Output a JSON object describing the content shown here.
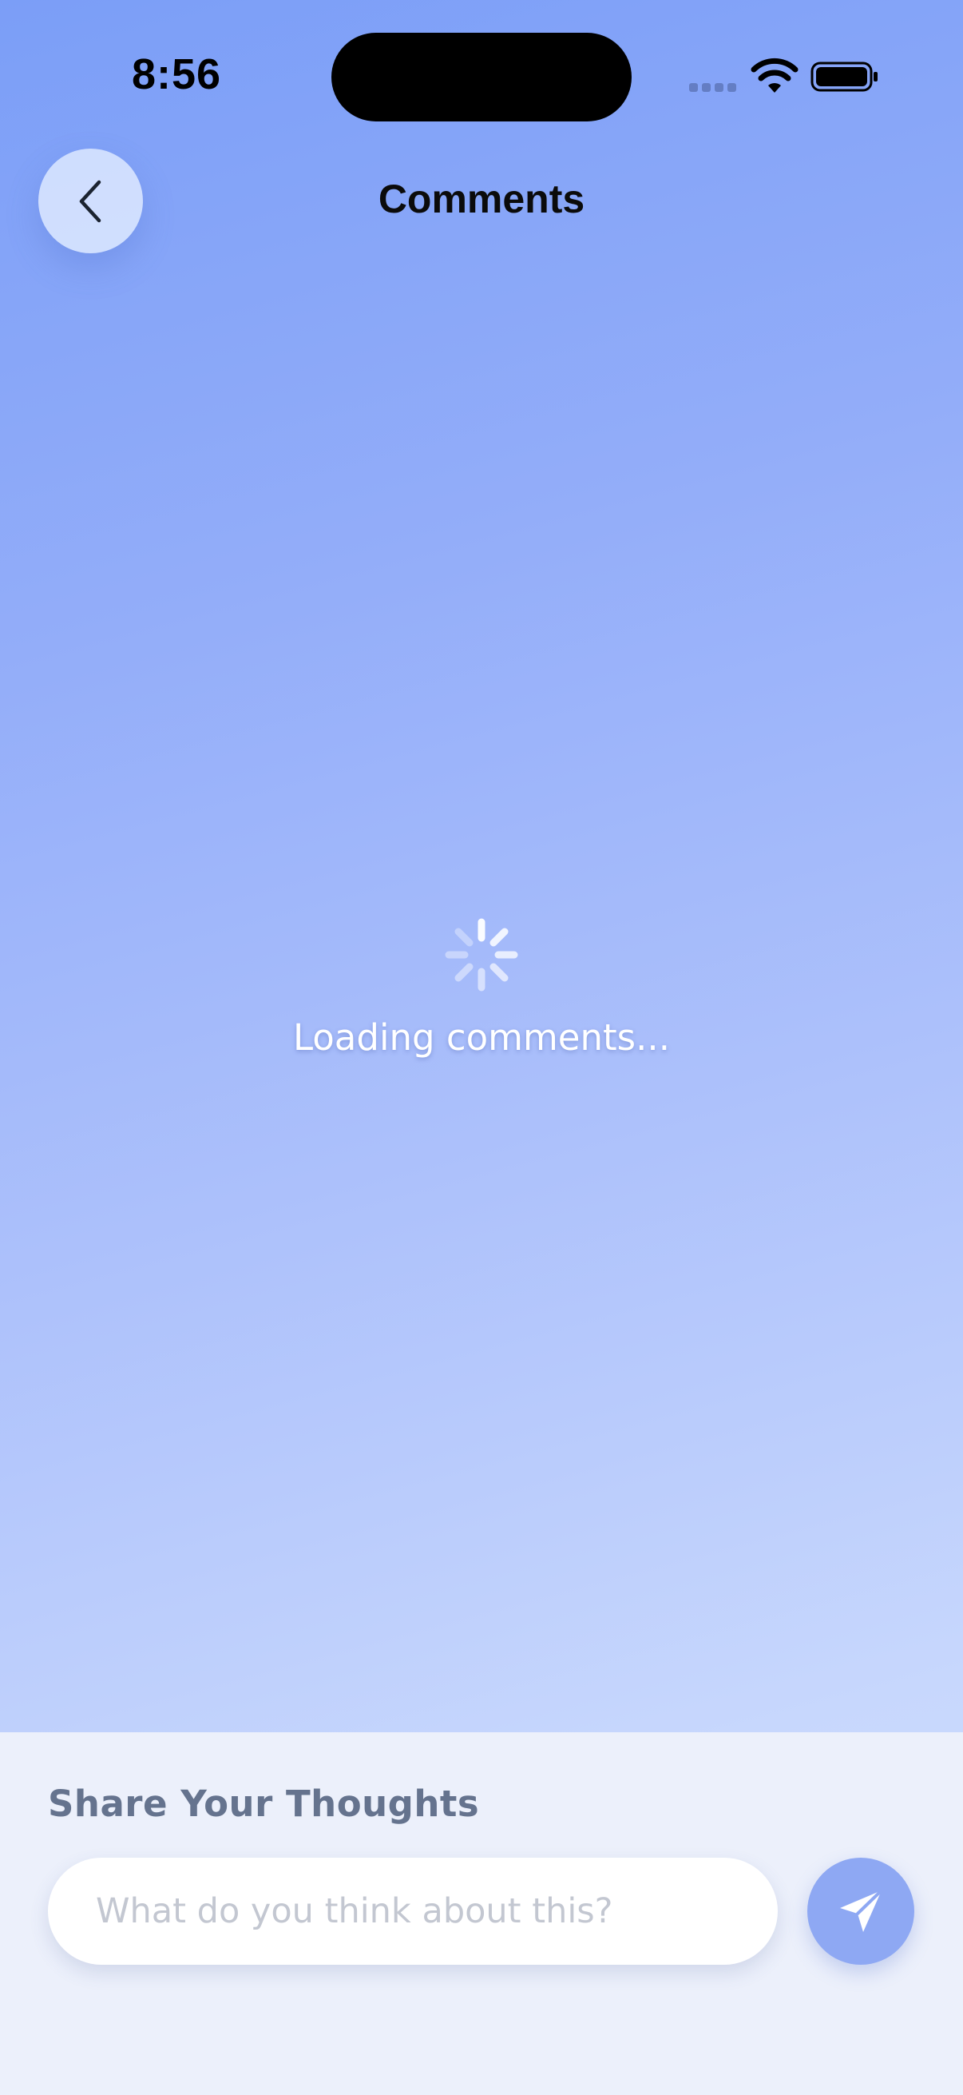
{
  "status_bar": {
    "time": "8:56"
  },
  "header": {
    "title": "Comments",
    "back_icon": "chevron-left-icon"
  },
  "main": {
    "loading_text": "Loading comments...",
    "spinner_icon": "activity-spinner-icon"
  },
  "composer": {
    "heading": "Share Your Thoughts",
    "input_placeholder": "What do you think about this?",
    "input_value": "",
    "send_icon": "paper-plane-icon"
  },
  "colors": {
    "gradient_top": "#7b9ef7",
    "gradient_bottom": "#d1ddfe",
    "panel_background": "#ecf0fb",
    "send_button": "#8ea8f3",
    "heading_text": "#65738e"
  }
}
